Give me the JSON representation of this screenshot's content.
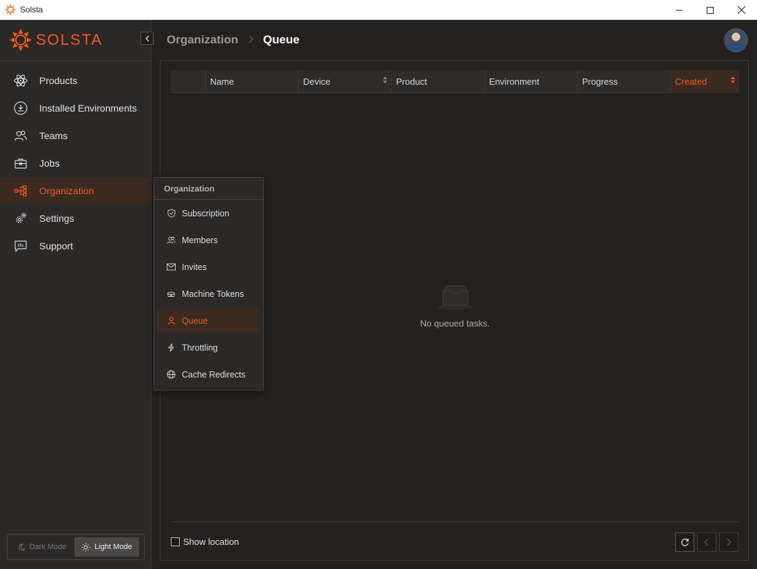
{
  "window": {
    "title": "Solsta"
  },
  "brand": {
    "name": "SOLSTA",
    "accent": "#f15a22"
  },
  "sidebar": {
    "items": [
      {
        "label": "Products",
        "icon": "atom-icon"
      },
      {
        "label": "Installed Environments",
        "icon": "download-circle-icon"
      },
      {
        "label": "Teams",
        "icon": "users-icon"
      },
      {
        "label": "Jobs",
        "icon": "briefcase-icon"
      },
      {
        "label": "Organization",
        "icon": "org-chart-icon",
        "active": true
      },
      {
        "label": "Settings",
        "icon": "gears-icon"
      },
      {
        "label": "Support",
        "icon": "chat-bars-icon"
      }
    ],
    "mode": {
      "dark_label": "Dark Mode",
      "light_label": "Light Mode",
      "selected": "Light Mode"
    }
  },
  "header": {
    "parent": "Organization",
    "current": "Queue"
  },
  "table": {
    "columns": [
      "",
      "Name",
      "Device",
      "Product",
      "Environment",
      "Progress",
      "Created"
    ],
    "sorted_column": "Created",
    "empty_text": "No queued tasks."
  },
  "footer": {
    "show_location_label": "Show location",
    "show_location_checked": false
  },
  "flyout": {
    "title": "Organization",
    "items": [
      {
        "label": "Subscription",
        "icon": "shield-icon"
      },
      {
        "label": "Members",
        "icon": "members-icon"
      },
      {
        "label": "Invites",
        "icon": "mail-icon"
      },
      {
        "label": "Machine Tokens",
        "icon": "token-icon"
      },
      {
        "label": "Queue",
        "icon": "person-icon",
        "active": true
      },
      {
        "label": "Throttling",
        "icon": "bolt-icon"
      },
      {
        "label": "Cache Redirects",
        "icon": "globe-icon"
      }
    ]
  }
}
